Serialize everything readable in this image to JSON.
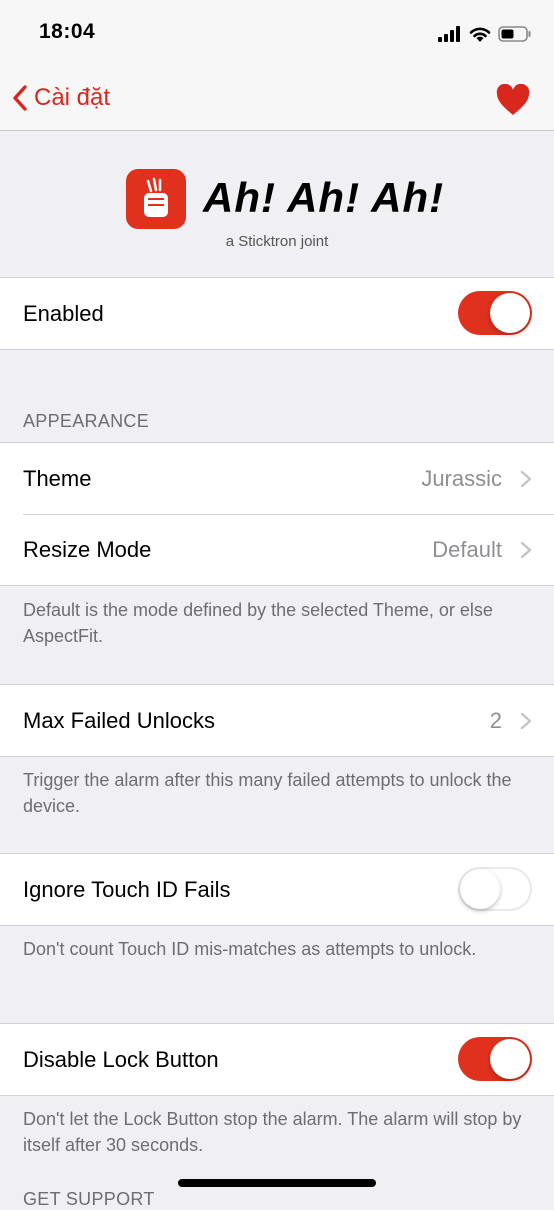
{
  "status_bar": {
    "time": "18:04",
    "icons": [
      "cellular-signal-icon",
      "wifi-icon",
      "battery-icon"
    ]
  },
  "nav": {
    "back_label": "Cài đặt",
    "back_icon": "chevron-left-icon",
    "right_icon": "heart-icon",
    "accent_color": "#d9271e"
  },
  "header": {
    "logo_icon": "raised-fist-icon",
    "title": "Ah! Ah! Ah!",
    "subtitle": "a Sticktron joint"
  },
  "enabled": {
    "label": "Enabled",
    "on": true
  },
  "appearance": {
    "header": "APPEARANCE",
    "theme_label": "Theme",
    "theme_value": "Jurassic",
    "resize_label": "Resize Mode",
    "resize_value": "Default",
    "footer": "Default is the mode defined by the selected Theme, or else AspectFit."
  },
  "max_failed": {
    "label": "Max Failed Unlocks",
    "value": "2",
    "footer": "Trigger the alarm after this many failed attempts to unlock the device."
  },
  "touch_id": {
    "label": "Ignore Touch ID Fails",
    "on": false,
    "footer": "Don't count Touch ID mis-matches as attempts to unlock."
  },
  "lock_button": {
    "label": "Disable Lock Button",
    "on": true,
    "footer": "Don't let the Lock Button stop the alarm. The alarm will stop by itself after 30 seconds."
  },
  "support": {
    "header": "GET SUPPORT"
  }
}
